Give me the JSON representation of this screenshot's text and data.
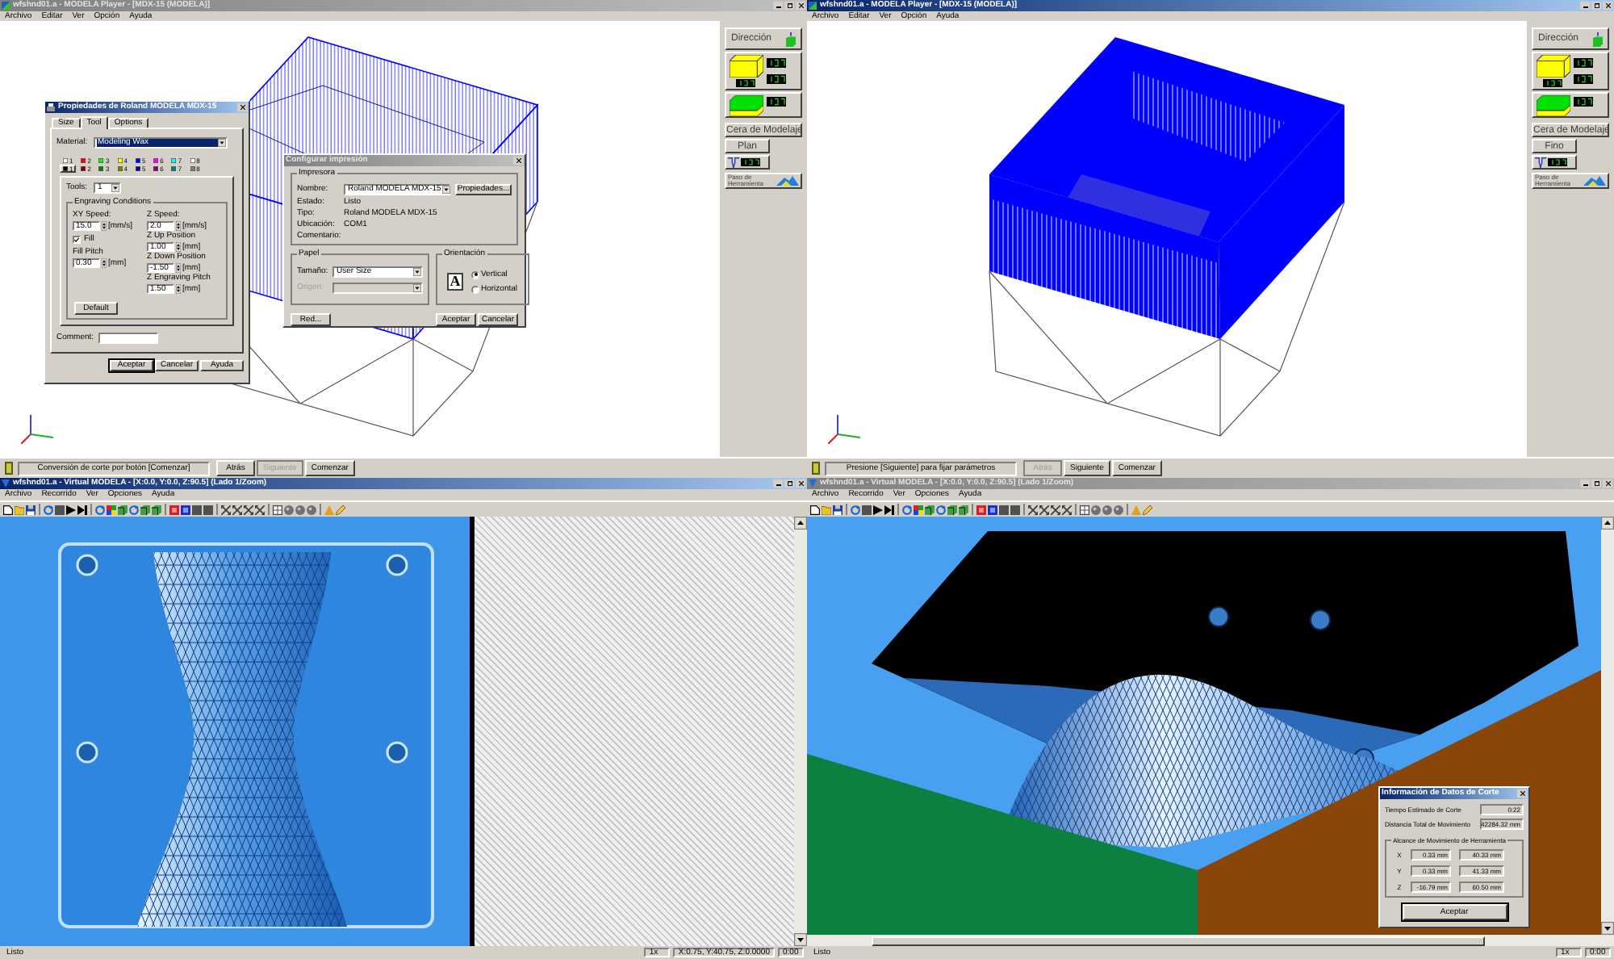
{
  "windows": [
    {
      "kind": "player",
      "active": false,
      "title": "wfshnd01.a - MODELA Player - [MDX-15 (MODELA)]",
      "menu": [
        "Archivo",
        "Editar",
        "Ver",
        "Opción",
        "Ayuda"
      ],
      "view": {
        "kind": "wireframe"
      },
      "panel": {
        "direction": "Dirección",
        "material": "Cera de Modelaje",
        "quality": "Plan",
        "tool_path": "Paso de Herramienta"
      },
      "message": "Conversión de corte por botón [Comenzar]",
      "buttons": [
        {
          "label": "Atrás",
          "disabled": false
        },
        {
          "label": "Siguiente",
          "disabled": true
        },
        {
          "label": "Comenzar",
          "disabled": false
        }
      ],
      "dialogs": [
        {
          "kind": "properties",
          "active": true,
          "title": "Propiedades de Roland MODELA MDX-15",
          "tabs": [
            {
              "label": "Size",
              "selected": false
            },
            {
              "label": "Tool",
              "selected": true
            },
            {
              "label": "Options",
              "selected": false
            }
          ],
          "material": {
            "label": "Material:",
            "value": "Modeling Wax",
            "focused": true
          },
          "pens": [
            [
              {
                "number": "1",
                "color": "#ffffff",
                "selected": false
              },
              {
                "number": "2",
                "color": "#ff0000",
                "selected": false
              },
              {
                "number": "3",
                "color": "#00ff00",
                "selected": false
              },
              {
                "number": "4",
                "color": "#ffff00",
                "selected": false
              },
              {
                "number": "5",
                "color": "#0000ff",
                "selected": false
              },
              {
                "number": "6",
                "color": "#ff00ff",
                "selected": false
              },
              {
                "number": "7",
                "color": "#00ffff",
                "selected": false
              },
              {
                "number": "8",
                "color": "#ffffff",
                "selected": false
              }
            ],
            [
              {
                "number": "1",
                "color": "#000000",
                "selected": true
              },
              {
                "number": "2",
                "color": "#800000",
                "selected": false
              },
              {
                "number": "3",
                "color": "#008000",
                "selected": false
              },
              {
                "number": "4",
                "color": "#808000",
                "selected": false
              },
              {
                "number": "5",
                "color": "#000080",
                "selected": false
              },
              {
                "number": "6",
                "color": "#800080",
                "selected": false
              },
              {
                "number": "7",
                "color": "#008080",
                "selected": false
              },
              {
                "number": "8",
                "color": "#808080",
                "selected": false
              }
            ]
          ],
          "tools": {
            "label": "Tools:",
            "value": "1"
          },
          "group": "Engraving Conditions",
          "left_fields": [
            {
              "label": "XY Speed:",
              "value": "15.0",
              "unit": "[mm/s]"
            }
          ],
          "fill": {
            "label": "Fill",
            "checked": true
          },
          "fill_pitch": {
            "label": "Fill Pitch",
            "value": "0.30",
            "unit": "[mm]"
          },
          "right_fields": [
            {
              "label": "Z Speed:",
              "value": "2.0",
              "unit": "[mm/s]"
            },
            {
              "label": "Z Up Position",
              "value": "1.00",
              "unit": "[mm]"
            },
            {
              "label": "Z Down Position",
              "value": "-1.50",
              "unit": "[mm]"
            },
            {
              "label": "Z Engraving Pitch",
              "value": "1.50",
              "unit": "[mm]"
            }
          ],
          "default_button": "Default",
          "comment": {
            "label": "Comment:"
          },
          "buttons": [
            {
              "label": "Aceptar",
              "default": true
            },
            {
              "label": "Cancelar",
              "default": false
            },
            {
              "label": "Ayuda",
              "default": false
            }
          ]
        },
        {
          "kind": "print",
          "active": false,
          "title": "Configurar impresión",
          "printer_group": "Impresora",
          "name": {
            "label": "Nombre:",
            "value": "Roland MODELA MDX-15"
          },
          "properties_button": "Propiedades...",
          "info": [
            {
              "label": "Estado:",
              "value": "Listo"
            },
            {
              "label": "Tipo:",
              "value": "Roland MODELA MDX-15"
            },
            {
              "label": "Ubicación:",
              "value": "COM1"
            },
            {
              "label": "Comentario:"
            }
          ],
          "paper_group": "Papel",
          "size": {
            "label": "Tamaño:",
            "value": "User Size",
            "disabled": false
          },
          "source": {
            "label": "Origen:",
            "disabled": true
          },
          "orientation_group": "Orientación",
          "orientation_preview": "A",
          "orientations": [
            {
              "label": "Vertical",
              "selected": true
            },
            {
              "label": "Horizontal",
              "selected": false
            }
          ],
          "buttons": [
            {
              "label": "Red..."
            },
            {
              "label": "Aceptar"
            },
            {
              "label": "Cancelar"
            }
          ]
        }
      ]
    },
    {
      "kind": "player",
      "active": true,
      "title": "wfshnd01.a - MODELA Player - [MDX-15 (MODELA)]",
      "menu": [
        "Archivo",
        "Editar",
        "Ver",
        "Opción",
        "Ayuda"
      ],
      "view": {
        "kind": "solid"
      },
      "panel": {
        "direction": "Dirección",
        "material": "Cera de Modelaje",
        "quality": "Fino",
        "tool_path": "Paso de Herramienta"
      },
      "message": "Presione [Siguiente] para fijar parámetros",
      "buttons": [
        {
          "label": "Atrás",
          "disabled": true
        },
        {
          "label": "Siguiente",
          "disabled": false
        },
        {
          "label": "Comenzar",
          "disabled": false
        }
      ]
    },
    {
      "kind": "virtual",
      "active": true,
      "title": "wfshnd01.a - Virtual MODELA - [X:0.0, Y:0.0, Z:90.5] (Lado 1/Zoom)",
      "menu": [
        "Archivo",
        "Recorrido",
        "Ver",
        "Opciones",
        "Ayuda"
      ],
      "view": {
        "kind": "top"
      },
      "status": [
        "Listo",
        "1x",
        "X:0.75, Y:40.75, Z:0.0000",
        "0:00"
      ]
    },
    {
      "kind": "virtual",
      "active": false,
      "title": "wfshnd01.a - Virtual MODELA - [X:0.0, Y:0.0, Z:90.5] (Lado 1/Zoom)",
      "menu": [
        "Archivo",
        "Recorrido",
        "Ver",
        "Opciones",
        "Ayuda"
      ],
      "view": {
        "kind": "perspective"
      },
      "status": [
        "Listo",
        "1x",
        "0:00"
      ],
      "dialogs": [
        {
          "kind": "cutting_info",
          "active": true,
          "title": "Información de Datos de Corte",
          "rows": [
            {
              "label": "Tiempo Estimado de Corte",
              "value": "0:22"
            },
            {
              "label": "Distancia Total de Movimiento",
              "value": "42284.32 mm"
            }
          ],
          "range_group": "Alcance de Movimiento de Herramienta",
          "ranges": [
            {
              "axis": "X",
              "min": "0.33 mm",
              "max": "40.33 mm"
            },
            {
              "axis": "Y",
              "min": "0.33 mm",
              "max": "41.33 mm"
            },
            {
              "axis": "Z",
              "min": "-16.79 mm",
              "max": "60.50 mm"
            }
          ],
          "button": "Aceptar"
        }
      ]
    }
  ]
}
